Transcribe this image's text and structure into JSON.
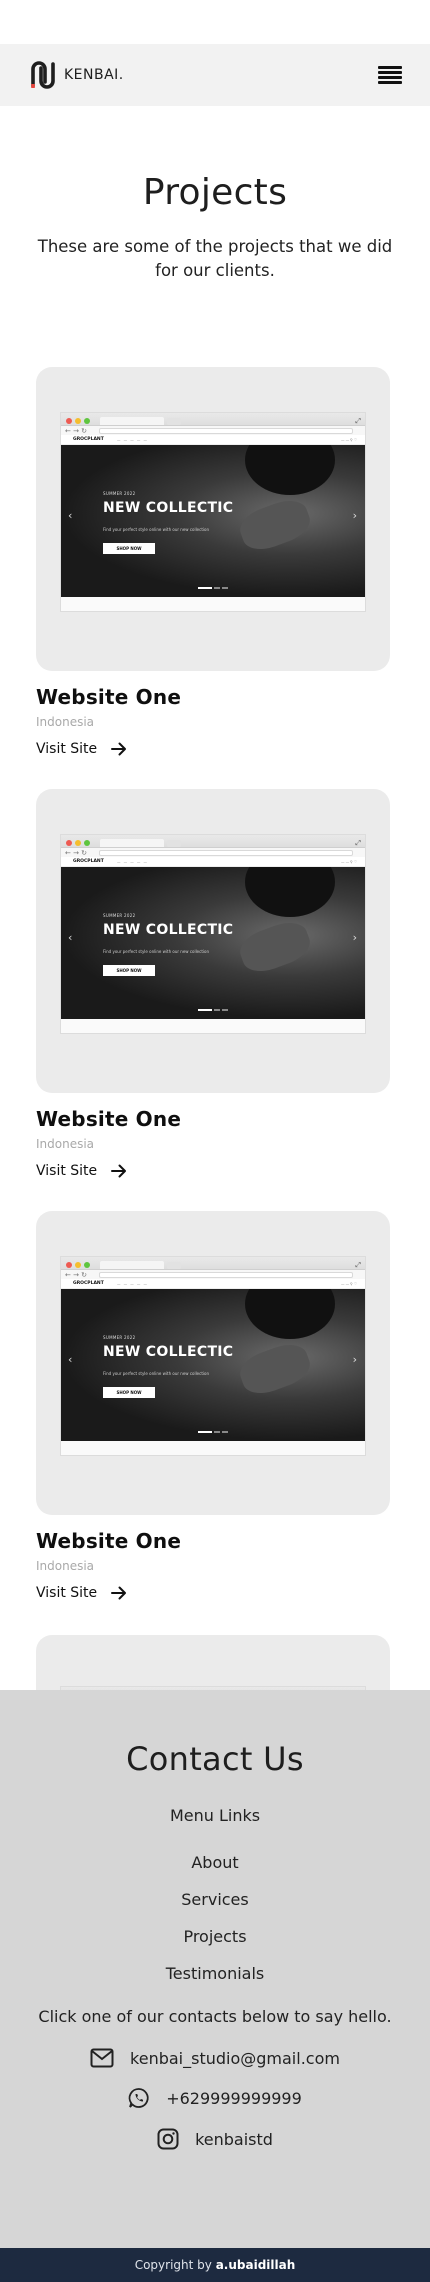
{
  "header": {
    "logo_text": "KENBAI.",
    "menu_icon": "hamburger-menu-icon"
  },
  "hero": {
    "title": "Projects",
    "subtitle": "These are some of the projects that we did for our clients."
  },
  "projects": [
    {
      "title": "Website One",
      "location": "Indonesia",
      "link_label": "Visit Site",
      "preview": {
        "brand": "GROCPLANT",
        "season": "SUMMER 2022",
        "headline": "NEW COLLECTIC",
        "tagline": "Find your perfect style online with our new collection",
        "cta": "SHOP NOW"
      }
    },
    {
      "title": "Website One",
      "location": "Indonesia",
      "link_label": "Visit Site",
      "preview": {
        "brand": "GROCPLANT",
        "season": "SUMMER 2022",
        "headline": "NEW COLLECTIC",
        "tagline": "Find your perfect style online with our new collection",
        "cta": "SHOP NOW"
      }
    },
    {
      "title": "Website One",
      "location": "Indonesia",
      "link_label": "Visit Site",
      "preview": {
        "brand": "GROCPLANT",
        "season": "SUMMER 2022",
        "headline": "NEW COLLECTIC",
        "tagline": "Find your perfect style online with our new collection",
        "cta": "SHOP NOW"
      }
    }
  ],
  "contact": {
    "title": "Contact Us",
    "menu_title": "Menu Links",
    "links": [
      "About",
      "Services",
      "Projects",
      "Testimonials"
    ],
    "prompt": "Click one of our contacts below to say hello.",
    "email": "kenbai_studio@gmail.com",
    "phone": "+629999999999",
    "instagram": "kenbaistd"
  },
  "footer": {
    "prefix": "Copyright by",
    "author": "a.ubaidillah"
  },
  "colors": {
    "header_bg": "#f2f2f2",
    "card_bg": "#ebebeb",
    "contact_bg": "#d6d6d6",
    "footer_bg": "#1d2a40"
  }
}
